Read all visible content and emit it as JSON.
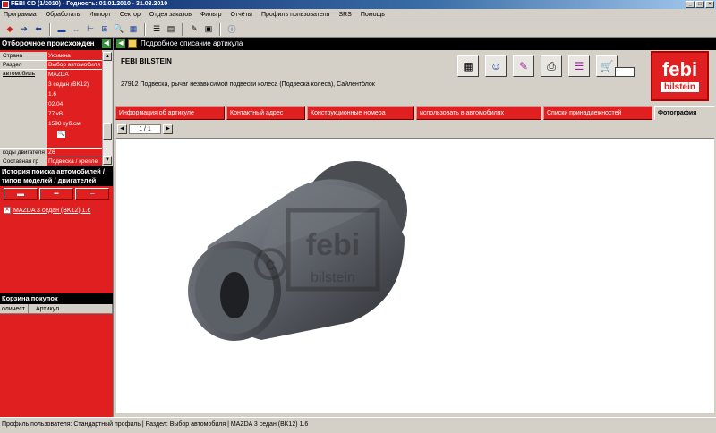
{
  "window": {
    "title": "FEBI CD (1/2010)  -  Годность: 01.01.2010 - 31.03.2010"
  },
  "menu": [
    "Программа",
    "Обработать",
    "Импорт",
    "Сектор",
    "Отдел заказов",
    "Фильтр",
    "Отчёты",
    "Профиль пользователя",
    "SRS",
    "Помощь"
  ],
  "left": {
    "selection_title": "Отборочное происхожден",
    "rows": [
      {
        "label": "Страна",
        "value": "Украина"
      },
      {
        "label": "Раздел",
        "value": "Выбор автомобиля"
      },
      {
        "label": "автомобиль",
        "values": [
          "MAZDA",
          "3 седан (BK12)",
          "1.6",
          "02.04",
          "77 кВ",
          "1598 куб.см"
        ]
      },
      {
        "label": "коды двигателя",
        "value": "Z6"
      },
      {
        "label": "Составная гр",
        "value": "Подвеска / крепле"
      }
    ],
    "history_title": "История поиска автомобилей / типов моделей / двигателей",
    "history_item": "MAZDA 3 седан (BK12) 1.6",
    "cart_title": "Корзина покупок",
    "cart_columns": [
      "оличест",
      "Артикул"
    ]
  },
  "detail": {
    "header": "Подробное описание артикула",
    "brand": "FEBI BILSTEIN",
    "description": "27912 Подвеска, рычаг независимой подвески колеса (Подвеска колеса), Сайлентблок",
    "logo_top": "febi",
    "logo_bottom": "bilstein",
    "tabs": [
      "Информация об артикуле",
      "Контактный адрес",
      "Конструкционные номера",
      "использовать в автомобилях",
      "Списки принадлежностей",
      "Фотография"
    ],
    "pager": "1  /  1",
    "watermark": "febi",
    "watermark_sub": "bilstein"
  },
  "status": {
    "text": "Профиль пользователя: Стандартный профиль | Раздел: Выбор автомобиля | MAZDA 3 седан (BK12) 1.6"
  },
  "colors": {
    "accent": "#e02020",
    "dark": "#000000",
    "chrome": "#d4d0c8"
  }
}
